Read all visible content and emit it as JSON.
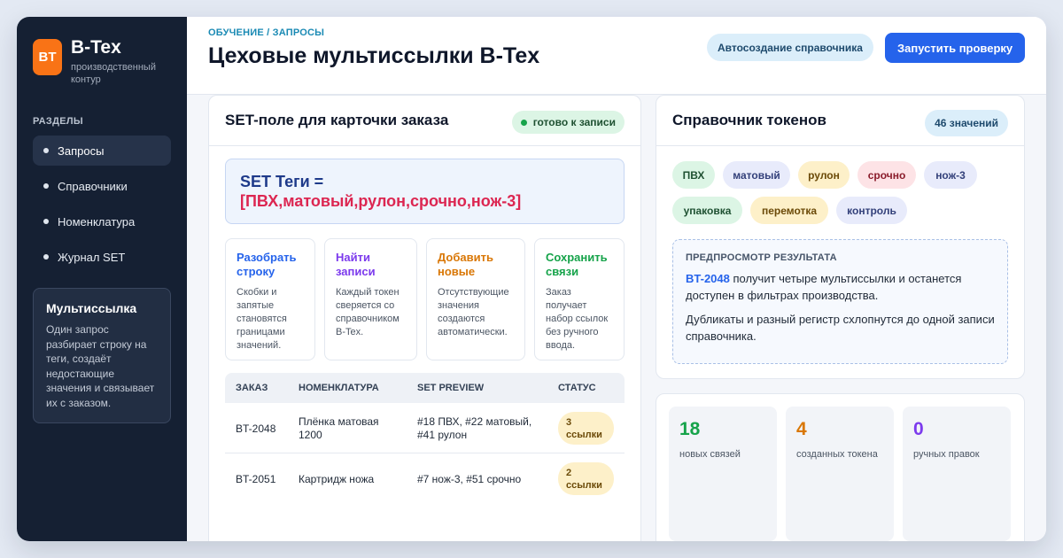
{
  "brand": {
    "logo": "BT",
    "name": "B-Tex",
    "subtitle": "производственный контур"
  },
  "sidebar": {
    "section_title": "РАЗДЕЛЫ",
    "items": [
      {
        "label": "Запросы",
        "active": true
      },
      {
        "label": "Справочники",
        "active": false
      },
      {
        "label": "Номенклатура",
        "active": false
      },
      {
        "label": "Журнал SET",
        "active": false
      }
    ],
    "info": {
      "title": "Мультиссылка",
      "text": "Один запрос разбирает строку на теги, создаёт недостающие значения и связывает их с заказом."
    }
  },
  "header": {
    "breadcrumb": "ОБУЧЕНИЕ / ЗАПРОСЫ",
    "title": "Цеховые мультиссылки B-Tex",
    "auto_button": "Автосоздание справочника",
    "run_button": "Запустить проверку"
  },
  "set_card": {
    "title": "SET-поле для карточки заказа",
    "status": "готово к записи",
    "line1": "SET Теги =",
    "line2": "[ПВХ,матовый,рулон,срочно,нож-3]",
    "steps": [
      {
        "title": "Разобрать строку",
        "text": "Скобки и запятые становятся границами значений.",
        "color": "#2563eb"
      },
      {
        "title": "Найти записи",
        "text": "Каждый токен сверяется со справочником B-Tex.",
        "color": "#7c3aed"
      },
      {
        "title": "Добавить новые",
        "text": "Отсутствующие значения создаются автоматически.",
        "color": "#d97706"
      },
      {
        "title": "Сохранить связи",
        "text": "Заказ получает набор ссылок без ручного ввода.",
        "color": "#16a34a"
      }
    ],
    "table": {
      "headers": [
        "ЗАКАЗ",
        "НОМЕНКЛАТУРА",
        "SET PREVIEW",
        "СТАТУС"
      ],
      "rows": [
        {
          "order": "BT-2048",
          "item": "Плёнка матовая 1200",
          "preview": "#18 ПВХ, #22 матовый, #41 рулон",
          "status": "3 ссылки"
        },
        {
          "order": "BT-2051",
          "item": "Картридж ножа",
          "preview": "#7 нож-3, #51 срочно",
          "status": "2 ссылки"
        }
      ]
    }
  },
  "tokens_card": {
    "title": "Справочник токенов",
    "count": "46 значений",
    "tokens": [
      {
        "label": "ПВХ",
        "bg": "#dcf5e5",
        "fg": "#1f5132"
      },
      {
        "label": "матовый",
        "bg": "#e8ebfb",
        "fg": "#33407a"
      },
      {
        "label": "рулон",
        "bg": "#fdf0c9",
        "fg": "#6b4a08"
      },
      {
        "label": "срочно",
        "bg": "#fde3e6",
        "fg": "#8a1c2b"
      },
      {
        "label": "нож-3",
        "bg": "#e8ebfb",
        "fg": "#33407a"
      },
      {
        "label": "упаковка",
        "bg": "#dcf5e5",
        "fg": "#1f5132"
      },
      {
        "label": "перемотка",
        "bg": "#fdf0c9",
        "fg": "#6b4a08"
      },
      {
        "label": "контроль",
        "bg": "#e8ebfb",
        "fg": "#33407a"
      }
    ],
    "preview": {
      "title": "ПРЕДПРОСМОТР РЕЗУЛЬТАТА",
      "order": "BT-2048",
      "text1": " получит четыре мультиссылки и останется доступен в фильтрах производства.",
      "text2": "Дубликаты и разный регистр схлопнутся до одной записи справочника."
    }
  },
  "stats": [
    {
      "value": "18",
      "label": "новых связей",
      "color": "#16a34a"
    },
    {
      "value": "4",
      "label": "созданных токена",
      "color": "#d97706"
    },
    {
      "value": "0",
      "label": "ручных правок",
      "color": "#7c3aed"
    }
  ]
}
